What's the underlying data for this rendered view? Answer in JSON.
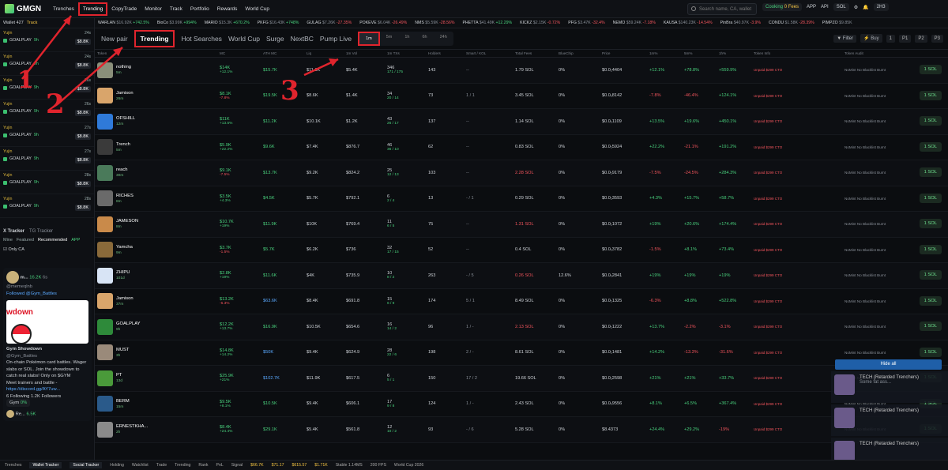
{
  "brand": {
    "name": "GMGN"
  },
  "nav": [
    "Trenches",
    "Trending",
    "CopyTrade",
    "Monitor",
    "Track",
    "Portfolio",
    "Rewards",
    "World Cup"
  ],
  "search": {
    "placeholder": "Search name, CA, wallet"
  },
  "topright": {
    "cooking": "Cooking",
    "free": "0 Fees",
    "app": "APP",
    "api": "API",
    "chain": "SOL",
    "user": "2H3"
  },
  "ticker": [
    {
      "name": "WARLAN",
      "mc": "$16.92K",
      "chg": "+742.5%",
      "c": "green"
    },
    {
      "name": "BioCo",
      "mc": "$3.99K",
      "chg": "+994%",
      "c": "green"
    },
    {
      "name": "MARIO",
      "mc": "$15.3K",
      "chg": "+670.2%",
      "c": "green"
    },
    {
      "name": "PKFG",
      "mc": "$16.43K",
      "chg": "+748%",
      "c": "green"
    },
    {
      "name": "GULAG",
      "mc": "$7.26K",
      "chg": "-27.35%",
      "c": "red"
    },
    {
      "name": "POKEVE",
      "mc": "$6.04K",
      "chg": "-26.49%",
      "c": "red"
    },
    {
      "name": "NMS",
      "mc": "$5.59K",
      "chg": "-28.56%",
      "c": "red"
    },
    {
      "name": "PHETTA",
      "mc": "$41.49K",
      "chg": "+12.29%",
      "c": "green"
    },
    {
      "name": "KICKZ",
      "mc": "$2.15K",
      "chg": "-0.72%",
      "c": "red"
    },
    {
      "name": "PFG",
      "mc": "$3.47K",
      "chg": "-32.4%",
      "c": "red"
    },
    {
      "name": "NEMO",
      "mc": "$59.24K",
      "chg": "-7.18%",
      "c": "red"
    },
    {
      "name": "KAUSA",
      "mc": "$140.23K",
      "chg": "-14.54%",
      "c": "red"
    },
    {
      "name": "PinBra",
      "mc": "$40.97K",
      "chg": "-3.9%",
      "c": "red"
    },
    {
      "name": "CONDU",
      "mc": "$1.58K",
      "chg": "-28.39%",
      "c": "red"
    },
    {
      "name": "PIMPZO",
      "mc": "$9.85K",
      "chg": "",
      "c": "green"
    }
  ],
  "left": {
    "wallet_label": "Wallet 427",
    "track": "Track",
    "rows": [
      {
        "who": "Yujin",
        "sym": "GOALPLAY",
        "age": "9h",
        "time": "24s",
        "val": "$8.8K"
      },
      {
        "who": "Yujin",
        "sym": "GOALPLAY",
        "age": "9h",
        "time": "24s",
        "val": "$8.8K"
      },
      {
        "who": "Yujin",
        "sym": "GOALPLAY",
        "age": "9h",
        "time": "26s",
        "val": "$8.8K"
      },
      {
        "who": "Yujin",
        "sym": "GOALPLAY",
        "age": "9h",
        "time": "26s",
        "val": "$8.8K"
      },
      {
        "who": "Yujin",
        "sym": "GOALPLAY",
        "age": "9h",
        "time": "27s",
        "val": "$8.8K"
      },
      {
        "who": "Yujin",
        "sym": "GOALPLAY",
        "age": "9h",
        "time": "27s",
        "val": "$8.8K"
      },
      {
        "who": "Yujin",
        "sym": "GOALPLAY",
        "age": "9h",
        "time": "28s",
        "val": "$8.8K"
      },
      {
        "who": "Yujin",
        "sym": "GOALPLAY",
        "age": "9h",
        "time": "28s",
        "val": "$8.8K"
      }
    ],
    "xtracker": "X Tracker",
    "tg": "TG Tracker",
    "tabs": [
      "Mine",
      "Featured",
      "Recommended"
    ],
    "appbtn": "APP",
    "onlyca": "Only CA",
    "card": {
      "handle": "m...",
      "followers": "16.2K",
      "age": "6s",
      "user": "@memeqlnb",
      "followed": "Followed @Gym_Battles",
      "title": "Gym Showdown",
      "title_handle": "@Gym_Battles",
      "banner": "wdown",
      "desc": "On-chain Pokémon card battles. Wager slabs or SOL. Join the showdown to catch real slabs! Only on $GYM",
      "meet": "Meet trainers and battle -",
      "link": "https://discord.gg/AY7uw...",
      "following": "6 Following",
      "followers2": "1.2K Followers",
      "foot": "Gym",
      "foot_pct": "0%",
      "next": "Re...",
      "next_f": "6.5K"
    }
  },
  "main": {
    "tabs": [
      "New pair",
      "Trending",
      "Hot Searches",
      "World Cup",
      "Surge",
      "NextBC",
      "Pump Live"
    ],
    "times": [
      "1m",
      "5m",
      "1h",
      "6h",
      "24h"
    ],
    "right": {
      "filter": "Filter",
      "buy": "Buy",
      "qty": "1",
      "p1": "P1",
      "p2": "P2",
      "p3": "P3"
    },
    "headers": [
      "Token",
      "MC",
      "ATH MC",
      "Liq",
      "1m Vol",
      "1m TXs",
      "Holders",
      "Smart / KOL",
      "Total Fees",
      "BlueChip",
      "Price",
      "1m%",
      "5m%",
      "1h%",
      "Token Info",
      "Token Audit"
    ],
    "rows": [
      {
        "n": "nothing",
        "age": "5m",
        "mc": "$14K",
        "mcc": "+12.1%",
        "ath": "$15.7K",
        "liq": "$11.1K",
        "vol": "$5.4K",
        "tx": "346",
        "tx2": "171 / 175",
        "hold": "143",
        "skol": "--",
        "fees": "1.79 SOL",
        "bc": "0%",
        "price": "$0.0₁4404",
        "p1": "+12.1%",
        "p5": "+78.8%",
        "p1h": "+559.9%",
        "p1c": "green",
        "p5c": "green",
        "phc": "green",
        "img": "#8a8f7a"
      },
      {
        "n": "Jamison",
        "age": "26m",
        "mc": "$8.1K",
        "mcc": "-7.8%",
        "ath": "$19.5K",
        "liq": "$8.6K",
        "vol": "$1.4K",
        "tx": "34",
        "tx2": "20 / 14",
        "hold": "73",
        "skol": "1 / 1",
        "fees": "3.45 SOL",
        "bc": "0%",
        "price": "$0.0₁8142",
        "p1": "-7.8%",
        "p5": "-46.4%",
        "p1h": "+124.1%",
        "p1c": "red",
        "p5c": "red",
        "phc": "green",
        "img": "#d9a56b"
      },
      {
        "n": "OFSHILL",
        "age": "12m",
        "mc": "$11K",
        "mcc": "+13.5%",
        "ath": "$11.2K",
        "liq": "$10.1K",
        "vol": "$1.2K",
        "tx": "43",
        "tx2": "26 / 17",
        "hold": "137",
        "skol": "--",
        "fees": "1.14 SOL",
        "bc": "0%",
        "price": "$0.0₁1109",
        "p1": "+13.5%",
        "p5": "+19.6%",
        "p1h": "+450.1%",
        "p1c": "green",
        "p5c": "green",
        "phc": "green",
        "img": "#2f7ad9"
      },
      {
        "n": "Trench",
        "age": "5m",
        "mc": "$5.9K",
        "mcc": "+22.2%",
        "ath": "$9.6K",
        "liq": "$7.4K",
        "vol": "$876.7",
        "tx": "46",
        "tx2": "36 / 10",
        "hold": "62",
        "skol": "--",
        "fees": "0.83 SOL",
        "bc": "0%",
        "price": "$0.0₁5924",
        "p1": "+22.2%",
        "p5": "-21.1%",
        "p1h": "+191.2%",
        "p1c": "green",
        "p5c": "red",
        "phc": "green",
        "img": "#3a3a3a"
      },
      {
        "n": "reach",
        "age": "30m",
        "mc": "$9.1K",
        "mcc": "-7.5%",
        "ath": "$13.7K",
        "liq": "$9.2K",
        "vol": "$824.2",
        "tx": "25",
        "tx2": "12 / 13",
        "hold": "103",
        "skol": "--",
        "fees": "2.28 SOL",
        "bc": "0%",
        "price": "$0.0₁9179",
        "p1": "-7.5%",
        "p5": "-24.5%",
        "p1h": "+284.3%",
        "p1c": "red",
        "p5c": "red",
        "phc": "green",
        "img": "#4a7a5a"
      },
      {
        "n": "RICHES",
        "age": "8m",
        "mc": "$3.5K",
        "mcc": "+4.3%",
        "ath": "$4.5K",
        "liq": "$5.7K",
        "vol": "$792.1",
        "tx": "6",
        "tx2": "2 / 4",
        "hold": "13",
        "skol": "- / 1",
        "fees": "0.29 SOL",
        "bc": "0%",
        "price": "$0.0₁3593",
        "p1": "+4.3%",
        "p5": "+15.7%",
        "p1h": "+58.7%",
        "p1c": "green",
        "p5c": "green",
        "phc": "green",
        "img": "#6a6a6a"
      },
      {
        "n": "JAMESON",
        "age": "8m",
        "mc": "$10.7K",
        "mcc": "+19%",
        "ath": "$11.9K",
        "liq": "$10K",
        "vol": "$769.4",
        "tx": "11",
        "tx2": "6 / 5",
        "hold": "75",
        "skol": "--",
        "fees": "1.31 SOL",
        "bc": "0%",
        "price": "$0.0₁1072",
        "p1": "+19%",
        "p5": "+20.6%",
        "p1h": "+174.4%",
        "p1c": "green",
        "p5c": "green",
        "phc": "green",
        "img": "#c98a4a"
      },
      {
        "n": "Yamcha",
        "age": "9m",
        "mc": "$3.7K",
        "mcc": "-1.5%",
        "ath": "$5.7K",
        "liq": "$6.2K",
        "vol": "$736",
        "tx": "32",
        "tx2": "17 / 15",
        "hold": "52",
        "skol": "--",
        "fees": "0.4 SOL",
        "bc": "0%",
        "price": "$0.0₁3782",
        "p1": "-1.5%",
        "p5": "+8.1%",
        "p1h": "+73.4%",
        "p1c": "red",
        "p5c": "green",
        "phc": "green",
        "img": "#8a6a3a"
      },
      {
        "n": "ZHIPU",
        "age": "101d",
        "mc": "$2.8K",
        "mcc": "+19%",
        "ath": "$11.6K",
        "liq": "$4K",
        "vol": "$735.9",
        "tx": "10",
        "tx2": "8 / 2",
        "hold": "263",
        "skol": "- / 5",
        "fees": "0.26 SOL",
        "bc": "12.6%",
        "price": "$0.0₁2841",
        "p1": "+19%",
        "p5": "+19%",
        "p1h": "+19%",
        "p1c": "green",
        "p5c": "green",
        "phc": "green",
        "img": "#d8e4f5"
      },
      {
        "n": "Jamison",
        "age": "37m",
        "mc": "$13.2K",
        "mcc": "-6.3%",
        "ath": "$63.6K",
        "liq": "$8.4K",
        "vol": "$691.8",
        "tx": "15",
        "tx2": "6 / 9",
        "hold": "174",
        "skol": "5 / 1",
        "fees": "8.49 SOL",
        "bc": "0%",
        "price": "$0.0₁1325",
        "p1": "-6.3%",
        "p5": "+8.8%",
        "p1h": "+522.8%",
        "p1c": "red",
        "p5c": "green",
        "phc": "green",
        "img": "#d9a56b"
      },
      {
        "n": "GOALPLAY",
        "age": "9h",
        "mc": "$12.2K",
        "mcc": "+13.7%",
        "ath": "$16.9K",
        "liq": "$10.5K",
        "vol": "$654.6",
        "tx": "16",
        "tx2": "14 / 2",
        "hold": "96",
        "skol": "1 / -",
        "fees": "2.13 SOL",
        "bc": "0%",
        "price": "$0.0₁1222",
        "p1": "+13.7%",
        "p5": "-2.2%",
        "p1h": "-3.1%",
        "p1c": "green",
        "p5c": "red",
        "phc": "red",
        "img": "#2e8a3a"
      },
      {
        "n": "MUST",
        "age": "3h",
        "mc": "$14.8K",
        "mcc": "+14.2%",
        "ath": "$50K",
        "liq": "$9.4K",
        "vol": "$624.9",
        "tx": "28",
        "tx2": "22 / 6",
        "hold": "198",
        "skol": "2 / -",
        "fees": "8.61 SOL",
        "bc": "0%",
        "price": "$0.0₁1481",
        "p1": "+14.2%",
        "p5": "-13.3%",
        "p1h": "-31.6%",
        "p1c": "green",
        "p5c": "red",
        "phc": "red",
        "img": "#9a8a7a"
      },
      {
        "n": "PT",
        "age": "13d",
        "mc": "$25.9K",
        "mcc": "+21%",
        "ath": "$102.7K",
        "liq": "$11.9K",
        "vol": "$617.5",
        "tx": "6",
        "tx2": "5 / 1",
        "hold": "150",
        "skol": "17 / 2",
        "fees": "19.66 SOL",
        "bc": "0%",
        "price": "$0.0₁2598",
        "p1": "+21%",
        "p5": "+21%",
        "p1h": "+33.7%",
        "p1c": "green",
        "p5c": "green",
        "phc": "green",
        "img": "#4a9a3a"
      },
      {
        "n": "BERM",
        "age": "15m",
        "mc": "$9.5K",
        "mcc": "+8.1%",
        "ath": "$10.5K",
        "liq": "$9.4K",
        "vol": "$606.1",
        "tx": "17",
        "tx2": "9 / 8",
        "hold": "124",
        "skol": "1 / -",
        "fees": "2.43 SOL",
        "bc": "0%",
        "price": "$0.0₁9556",
        "p1": "+8.1%",
        "p5": "+6.5%",
        "p1h": "+367.4%",
        "p1c": "green",
        "p5c": "green",
        "phc": "green",
        "img": "#2a5a8a"
      },
      {
        "n": "ERNESTKHA...",
        "age": "2h",
        "mc": "$8.4K",
        "mcc": "+24.4%",
        "ath": "$29.1K",
        "liq": "$5.4K",
        "vol": "$561.8",
        "tx": "12",
        "tx2": "10 / 2",
        "hold": "93",
        "skol": "- / 6",
        "fees": "5.28 SOL",
        "bc": "0%",
        "price": "$8.4373",
        "p1": "+24.4%",
        "p5": "+29.2%",
        "p1h": "-19%",
        "p1c": "green",
        "p5c": "green",
        "phc": "red",
        "img": "#8a8a8a"
      }
    ],
    "buy": "1 SOL",
    "audit": [
      "NoMint",
      "No Blacklist",
      "Burnt"
    ],
    "info": "Unpaid  $299 CTO"
  },
  "notif": {
    "hide": "Hide all",
    "items": [
      {
        "t": "TECH (Retarded Trenchers)",
        "s": "Some fat ass..."
      },
      {
        "t": "TECH (Retarded Trenchers)",
        "s": ""
      },
      {
        "t": "TECH (Retarded Trenchers)",
        "s": ""
      }
    ]
  },
  "bottom": [
    "Trenches",
    "Wallet Tracker",
    "Social Tracker",
    "Holding",
    "Watchlist",
    "Trade",
    "Trending",
    "Rank",
    "PnL",
    "Signal",
    "$66.7K",
    "$71.17",
    "$615.57",
    "$1.71K",
    "Stable 1.14MS",
    "200 FPS",
    "World Cup 2026"
  ],
  "annotations": [
    "1",
    "2",
    "3"
  ]
}
